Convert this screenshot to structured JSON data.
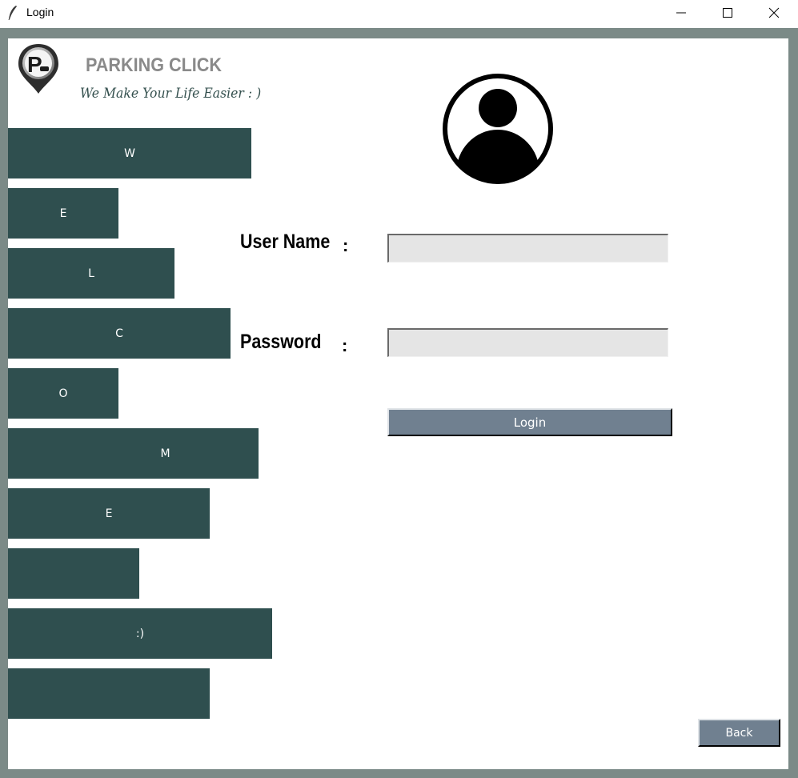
{
  "window": {
    "title": "Login",
    "icon": "feather-icon"
  },
  "brand": {
    "name": "PARKING CLICK",
    "tagline": "We Make Your Life Easier : )",
    "logo_icon": "parking-pin-icon"
  },
  "side_bars": [
    {
      "label": "W"
    },
    {
      "label": "E"
    },
    {
      "label": "L"
    },
    {
      "label": "C"
    },
    {
      "label": "O"
    },
    {
      "label": "M"
    },
    {
      "label": "E"
    },
    {
      "label": ""
    },
    {
      "label": ":)"
    },
    {
      "label": ""
    }
  ],
  "form": {
    "avatar_icon": "user-avatar-icon",
    "username_label": "User Name",
    "username_colon": ":",
    "username_value": "",
    "password_label": "Password",
    "password_colon": ":",
    "password_value": "",
    "login_label": "Login"
  },
  "back_label": "Back",
  "colors": {
    "bar": "#2f4f4f",
    "button": "#708090",
    "frame": "#7b8a87",
    "brand_text": "#8a8a8a"
  }
}
